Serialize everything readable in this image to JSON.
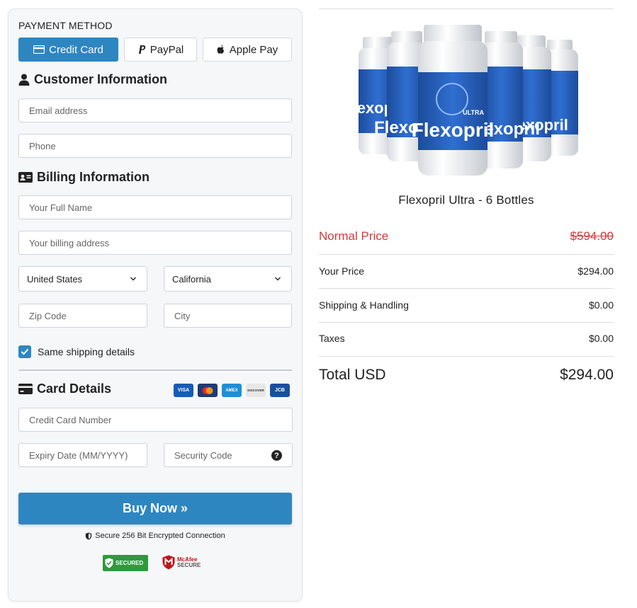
{
  "payment": {
    "title": "PAYMENT METHOD",
    "methods": [
      {
        "label": "Credit Card",
        "icon": "credit-card-icon",
        "active": true
      },
      {
        "label": "PayPal",
        "icon": "paypal-icon",
        "active": false
      },
      {
        "label": "Apple Pay",
        "icon": "apple-icon",
        "active": false
      }
    ]
  },
  "customer": {
    "heading": "Customer Information",
    "email_placeholder": "Email address",
    "phone_placeholder": "Phone"
  },
  "billing": {
    "heading": "Billing Information",
    "name_placeholder": "Your Full Name",
    "address_placeholder": "Your billing address",
    "country": "United States",
    "state": "California",
    "zip_placeholder": "Zip Code",
    "city_placeholder": "City",
    "same_shipping_label": "Same shipping details",
    "same_shipping_checked": true
  },
  "card": {
    "heading": "Card Details",
    "logos": [
      "VISA",
      "mastercard",
      "AMEX",
      "DISCOVER",
      "JCB"
    ],
    "number_placeholder": "Credit Card Number",
    "expiry_placeholder": "Expiry Date (MM/YYYY)",
    "cvc_placeholder": "Security Code",
    "help_glyph": "?"
  },
  "buy": {
    "label": "Buy Now »",
    "secure_text": "Secure 256 Bit Encrypted Connection"
  },
  "badges": {
    "secured": "SECURED",
    "mcafee_line1": "McAfee",
    "mcafee_line2": "SECURE"
  },
  "product": {
    "name": "Flexopril Ultra - 6 Bottles",
    "bottle_label": "Flexopril",
    "bottle_sub": "ULTRA"
  },
  "summary": {
    "normal_label": "Normal Price",
    "normal_value": "$594.00",
    "your_label": "Your Price",
    "your_value": "$294.00",
    "shipping_label": "Shipping & Handling",
    "shipping_value": "$0.00",
    "taxes_label": "Taxes",
    "taxes_value": "$0.00",
    "total_label": "Total USD",
    "total_value": "$294.00"
  },
  "colors": {
    "accent": "#2e86c1",
    "price_red": "#d23a3a",
    "badge_green": "#2e9a3b",
    "mcafee_red": "#c0161b"
  }
}
